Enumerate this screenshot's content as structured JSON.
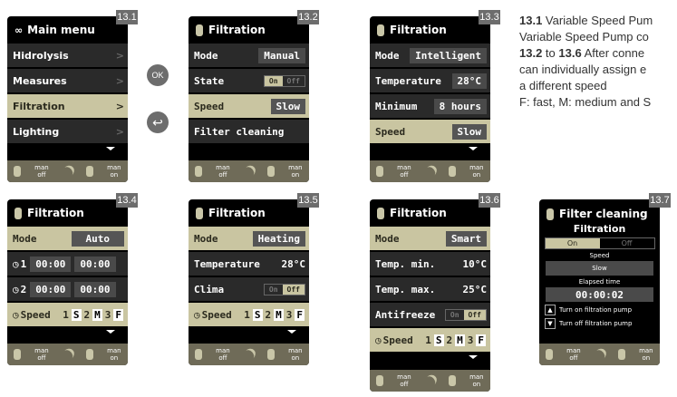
{
  "badges": [
    "13.1",
    "13.2",
    "13.3",
    "13.4",
    "13.5",
    "13.6",
    "13.7"
  ],
  "buttons": {
    "ok": "OK",
    "back": "↩"
  },
  "footer": {
    "left": "man\noff",
    "right": "man\non"
  },
  "s1": {
    "title": "Main menu",
    "items": [
      "Hidrolysis",
      "Measures",
      "Filtration",
      "Lighting"
    ]
  },
  "s2": {
    "title": "Filtration",
    "rows": [
      {
        "label": "Mode",
        "value": "Manual"
      },
      {
        "label": "State",
        "on": "On",
        "off": "Off"
      },
      {
        "label": "Speed",
        "value": "Slow"
      },
      {
        "label": "Filter cleaning"
      }
    ]
  },
  "s3": {
    "title": "Filtration",
    "rows": [
      {
        "label": "Mode",
        "value": "Intelligent"
      },
      {
        "label": "Temperature",
        "value": "28°C"
      },
      {
        "label": "Minimum",
        "value": "8 hours"
      },
      {
        "label": "Speed",
        "value": "Slow"
      }
    ]
  },
  "s4": {
    "title": "Filtration",
    "mode_label": "Mode",
    "mode_value": "Auto",
    "t1": {
      "n": "1",
      "a": "00:00",
      "b": "00:00"
    },
    "t2": {
      "n": "2",
      "a": "00:00",
      "b": "00:00"
    },
    "speed": {
      "label": "Speed",
      "v1": "1",
      "s": "S",
      "v2": "2",
      "m": "M",
      "v3": "3",
      "f": "F"
    }
  },
  "s5": {
    "title": "Filtration",
    "mode_label": "Mode",
    "mode_value": "Heating",
    "temp_label": "Temperature",
    "temp_value": "28°C",
    "clima_label": "Clima",
    "on": "On",
    "off": "Off",
    "speed": {
      "label": "Speed",
      "v1": "1",
      "s": "S",
      "v2": "2",
      "m": "M",
      "v3": "3",
      "f": "F"
    }
  },
  "s6": {
    "title": "Filtration",
    "mode_label": "Mode",
    "mode_value": "Smart",
    "tmin_label": "Temp. min.",
    "tmin_value": "10°C",
    "tmax_label": "Temp. max.",
    "tmax_value": "25°C",
    "anti_label": "Antifreeze",
    "on": "On",
    "off": "Off",
    "speed": {
      "label": "Speed",
      "v1": "1",
      "s": "S",
      "v2": "2",
      "m": "M",
      "v3": "3",
      "f": "F"
    }
  },
  "s7": {
    "title": "Filter cleaning",
    "subtitle": "Filtration",
    "on": "On",
    "off": "Off",
    "speed_label": "Speed",
    "speed_value": "Slow",
    "elapsed_label": "Elapsed time",
    "elapsed_value": "00:00:02",
    "act1": "Turn on filtration pump",
    "act2": "Turn off filtration pump"
  },
  "caption": {
    "l1a": "13.1",
    "l1b": " Variable Speed Pum",
    "l2": "Variable Speed Pump co",
    "l3a": "13.2",
    "l3b": " to ",
    "l3c": "13.6",
    "l3d": " After conne",
    "l4": "can individually assign e",
    "l5": "a different speed",
    "l6": "F: fast, M: medium and S"
  }
}
